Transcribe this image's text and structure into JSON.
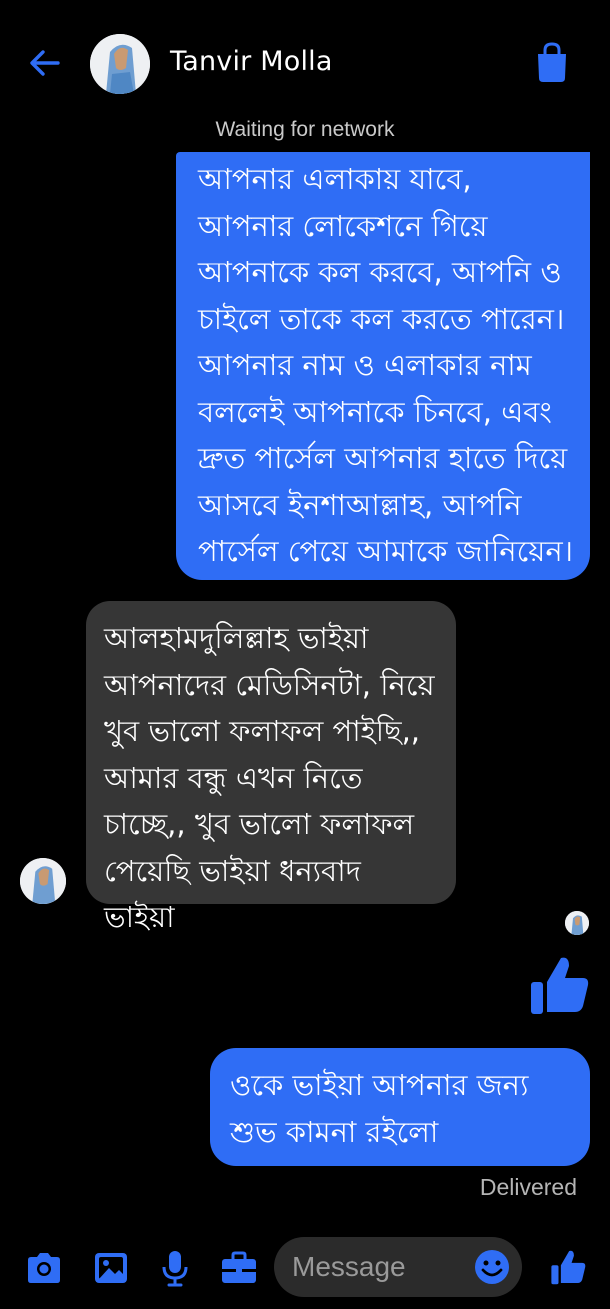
{
  "header": {
    "contact_name": "Tanvir Molla",
    "icons": {
      "back": "arrow-left-icon",
      "action": "shopping-bag-icon"
    }
  },
  "status": "Waiting for network",
  "messages": [
    {
      "direction": "sent",
      "text": "আপনার এলাকায় যাবে, আপনার লোকেশনে গিয়ে আপনাকে কল করবে, আপনি ও চাইলে তাকে কল করতে পারেন। আপনার নাম ও এলাকার নাম বললেই আপনাকে চিনবে, এবং দ্রুত পার্সেল আপনার হাতে দিয়ে আসবে ইনশাআল্লাহ, আপনি পার্সেল পেয়ে আমাকে জানিয়েন।"
    },
    {
      "direction": "received",
      "text": "আলহামদুলিল্লাহ ভাইয়া আপনাদের মেডিসিনটা, নিয়ে খুব ভালো ফলাফল পাইছি,, আমার বন্ধু এখন নিতে চাচ্ছে,, খুব ভালো ফলাফল পেয়েছি ভাইয়া ধন্যবাদ ভাইয়া"
    },
    {
      "direction": "sent",
      "type": "like",
      "icon": "thumbs-up-icon"
    },
    {
      "direction": "sent",
      "text": "ওকে ভাইয়া আপনার জন্য শুভ কামনা রইলো"
    }
  ],
  "delivery_status": "Delivered",
  "composer": {
    "placeholder": "Message",
    "icons": [
      "camera-icon",
      "image-icon",
      "microphone-icon",
      "briefcase-icon",
      "emoji-icon",
      "thumbs-up-icon"
    ]
  },
  "colors": {
    "accent": "#2f6df5",
    "background": "#000000",
    "received_bubble": "#363636",
    "composer_field": "#2b2b2b"
  }
}
